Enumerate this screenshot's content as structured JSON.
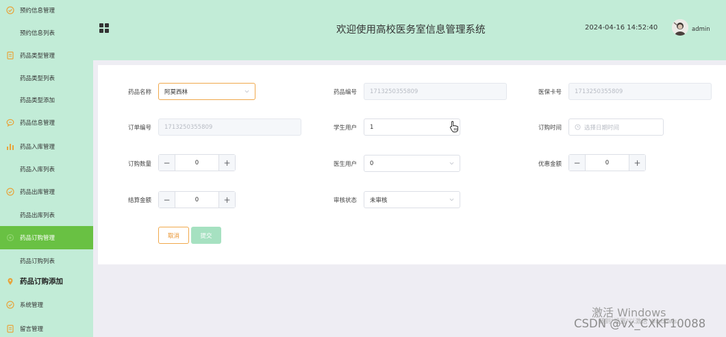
{
  "sidebar": {
    "items": [
      {
        "label": "预约信息管理",
        "type": "group",
        "icon": "check-circle-icon"
      },
      {
        "label": "预约信息列表",
        "type": "sub"
      },
      {
        "label": "药品类型管理",
        "type": "group",
        "icon": "document-icon"
      },
      {
        "label": "药品类型列表",
        "type": "sub"
      },
      {
        "label": "药品类型添加",
        "type": "sub"
      },
      {
        "label": "药品信息管理",
        "type": "group",
        "icon": "chat-icon"
      },
      {
        "label": "药品入库管理",
        "type": "group",
        "icon": "bar-chart-icon"
      },
      {
        "label": "药品入库列表",
        "type": "sub"
      },
      {
        "label": "药品出库管理",
        "type": "group",
        "icon": "check-circle-icon"
      },
      {
        "label": "药品出库列表",
        "type": "sub"
      },
      {
        "label": "药品订购管理",
        "type": "group",
        "icon": "gear-icon",
        "active": true
      },
      {
        "label": "药品订购列表",
        "type": "sub"
      },
      {
        "label": "药品订购添加",
        "type": "group",
        "icon": "location-pin-icon"
      },
      {
        "label": "系统管理",
        "type": "group",
        "icon": "check-circle-icon"
      },
      {
        "label": "留言管理",
        "type": "group",
        "icon": "document-icon"
      }
    ]
  },
  "header": {
    "title": "欢迎使用高校医务室信息管理系统",
    "datetime": "2024-04-16 14:52:40",
    "username": "admin",
    "menu_icon": "grid-icon"
  },
  "form": {
    "drug_name": {
      "label": "药品名称",
      "value": "阿莫西林"
    },
    "drug_code": {
      "label": "药品编号",
      "value": "1713250355809"
    },
    "insurance_card": {
      "label": "医保卡号",
      "value": "1713250355809"
    },
    "order_no": {
      "label": "订单编号",
      "value": "1713250355809"
    },
    "student_user": {
      "label": "学生用户",
      "value": "1"
    },
    "order_time": {
      "label": "订购时间",
      "placeholder": "选择日期时间"
    },
    "quantity": {
      "label": "订购数量",
      "value": "0"
    },
    "doctor_user": {
      "label": "医生用户",
      "value": "0"
    },
    "discount": {
      "label": "优惠金额",
      "value": "0"
    },
    "settlement": {
      "label": "结算金额",
      "value": "0"
    },
    "review_status": {
      "label": "审核状态",
      "value": "未审核"
    },
    "cancel_label": "取消",
    "submit_label": "提交"
  },
  "watermark": {
    "activate": "激活 Windows",
    "activate_sub": "转到\"设置\"以激活 Windows。",
    "csdn": "CSDN @vx_CXKF10088"
  },
  "colors": {
    "sidebar_bg": "#c2ecd7",
    "active_item": "#69c143",
    "accent_orange": "#f0a84b",
    "submit_bg": "#a6e1c1"
  }
}
